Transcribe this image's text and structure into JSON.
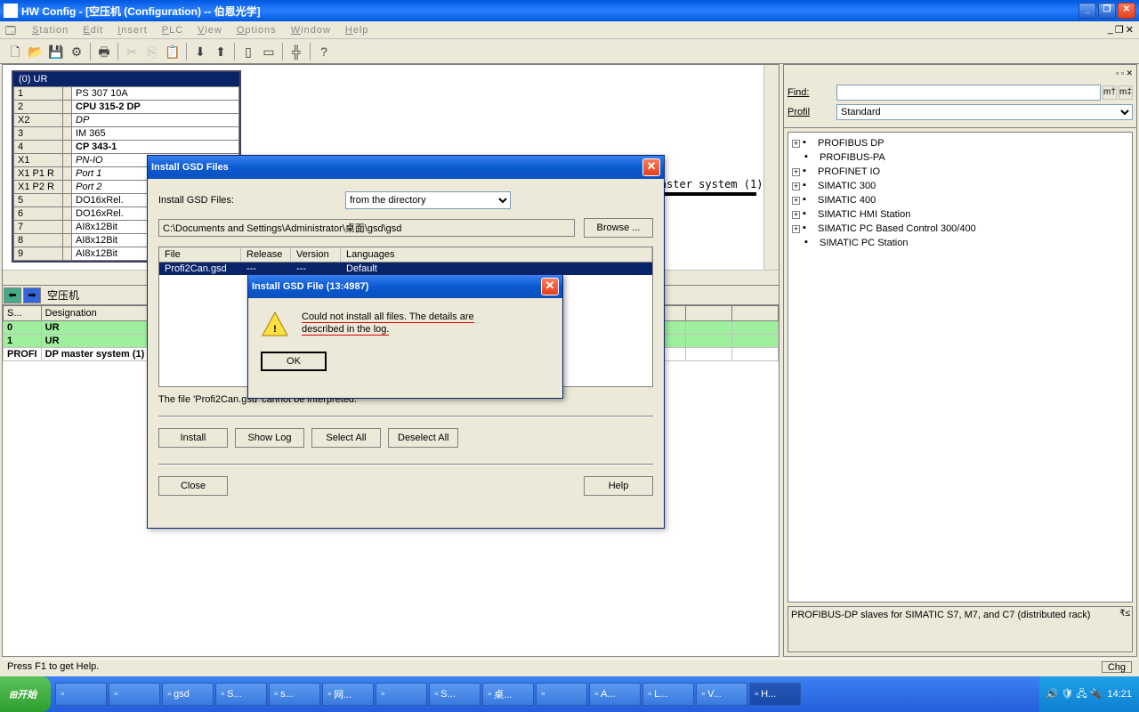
{
  "app": {
    "title": "HW Config - [空压机 (Configuration) -- 伯恩光学]"
  },
  "menubar": [
    "Station",
    "Edit",
    "Insert",
    "PLC",
    "View",
    "Options",
    "Window",
    "Help"
  ],
  "rack": {
    "title": "(0) UR",
    "rows": [
      {
        "slot": "1",
        "module": "PS 307 10A"
      },
      {
        "slot": "2",
        "module": "CPU 315-2 DP",
        "bold": true
      },
      {
        "slot": "X2",
        "module": "DP",
        "italic": true
      },
      {
        "slot": "3",
        "module": "IM 365"
      },
      {
        "slot": "4",
        "module": "CP 343-1",
        "bold": true
      },
      {
        "slot": "X1",
        "module": "PN-IO",
        "italic": true
      },
      {
        "slot": "X1 P1 R",
        "module": "Port 1",
        "italic": true
      },
      {
        "slot": "X1 P2 R",
        "module": "Port 2",
        "italic": true
      },
      {
        "slot": "5",
        "module": "DO16xRel."
      },
      {
        "slot": "6",
        "module": "DO16xRel."
      },
      {
        "slot": "7",
        "module": "AI8x12Bit"
      },
      {
        "slot": "8",
        "module": "AI8x12Bit"
      },
      {
        "slot": "9",
        "module": "AI8x12Bit"
      }
    ]
  },
  "bus_label": "PROFIBUS(1): DP master system (1)",
  "lower": {
    "nav_label": "空压机",
    "headers": [
      "S...",
      "Designation"
    ],
    "rows": [
      {
        "slot": "0",
        "name": "UR",
        "green": true
      },
      {
        "slot": "1",
        "name": "UR",
        "green": true
      },
      {
        "slot": "PROFI",
        "name": "DP master system (1)"
      }
    ]
  },
  "catalog": {
    "find_label": "Find:",
    "profile_label": "Profil",
    "profile_value": "Standard",
    "items": [
      {
        "exp": "+",
        "name": "PROFIBUS DP"
      },
      {
        "exp": "",
        "name": "PROFIBUS-PA"
      },
      {
        "exp": "+",
        "name": "PROFINET IO"
      },
      {
        "exp": "+",
        "name": "SIMATIC 300"
      },
      {
        "exp": "+",
        "name": "SIMATIC 400"
      },
      {
        "exp": "+",
        "name": "SIMATIC HMI Station"
      },
      {
        "exp": "+",
        "name": "SIMATIC PC Based Control 300/400"
      },
      {
        "exp": "",
        "name": "SIMATIC PC Station"
      }
    ],
    "description": "PROFIBUS-DP slaves for SIMATIC S7, M7, and C7 (distributed rack)"
  },
  "dlg1": {
    "title": "Install GSD Files",
    "label": "Install GSD Files:",
    "source": "from the directory",
    "path": "C:\\Documents and Settings\\Administrator\\桌面\\gsd\\gsd",
    "browse": "Browse ...",
    "cols": {
      "file": "File",
      "release": "Release",
      "version": "Version",
      "langs": "Languages"
    },
    "row": {
      "file": "Profi2Can.gsd",
      "release": "---",
      "version": "---",
      "langs": "Default"
    },
    "status": "The file 'Profi2Can.gsd' cannot be interpreted.",
    "btns": {
      "install": "Install",
      "showlog": "Show Log",
      "selall": "Select All",
      "deselall": "Deselect All",
      "close": "Close",
      "help": "Help"
    }
  },
  "dlg2": {
    "title": "Install GSD File (13:4987)",
    "text1": "Could not install all files. The details are",
    "text2": "described in the log.",
    "ok": "OK"
  },
  "status": {
    "text": "Press F1 to get Help.",
    "chg": "Chg"
  },
  "taskbar": {
    "start": "开始",
    "items": [
      "",
      "",
      "gsd",
      "S...",
      "s...",
      "网...",
      "",
      "S...",
      "桌...",
      "",
      "A...",
      "L...",
      "V...",
      "H..."
    ],
    "time": "14:21"
  }
}
